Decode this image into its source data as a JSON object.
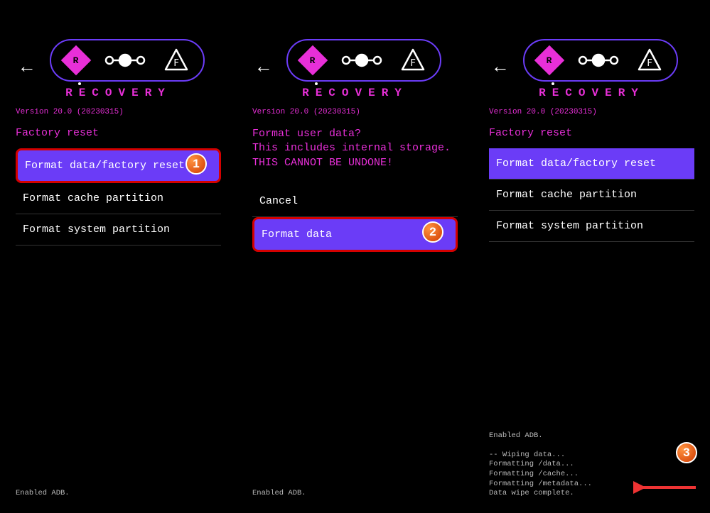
{
  "common": {
    "title": "RECOVERY",
    "version": "Version 20.0 (20230315)",
    "diamond_letter": "R",
    "triangle_letter": "F"
  },
  "panel1": {
    "section": "Factory reset",
    "items": [
      "Format data/factory reset",
      "Format cache partition",
      "Format system partition"
    ],
    "badge": "1",
    "log": "Enabled ADB."
  },
  "panel2": {
    "warn_line1": "Format user data?",
    "warn_line2": "This includes internal storage.",
    "warn_line3": "THIS CANNOT BE UNDONE!",
    "items": [
      "Cancel",
      "Format data"
    ],
    "badge": "2",
    "log": "Enabled ADB."
  },
  "panel3": {
    "section": "Factory reset",
    "items": [
      "Format data/factory reset",
      "Format cache partition",
      "Format system partition"
    ],
    "badge": "3",
    "log": "Enabled ADB.\n\n-- Wiping data...\nFormatting /data...\nFormatting /cache...\nFormatting /metadata...\nData wipe complete."
  }
}
